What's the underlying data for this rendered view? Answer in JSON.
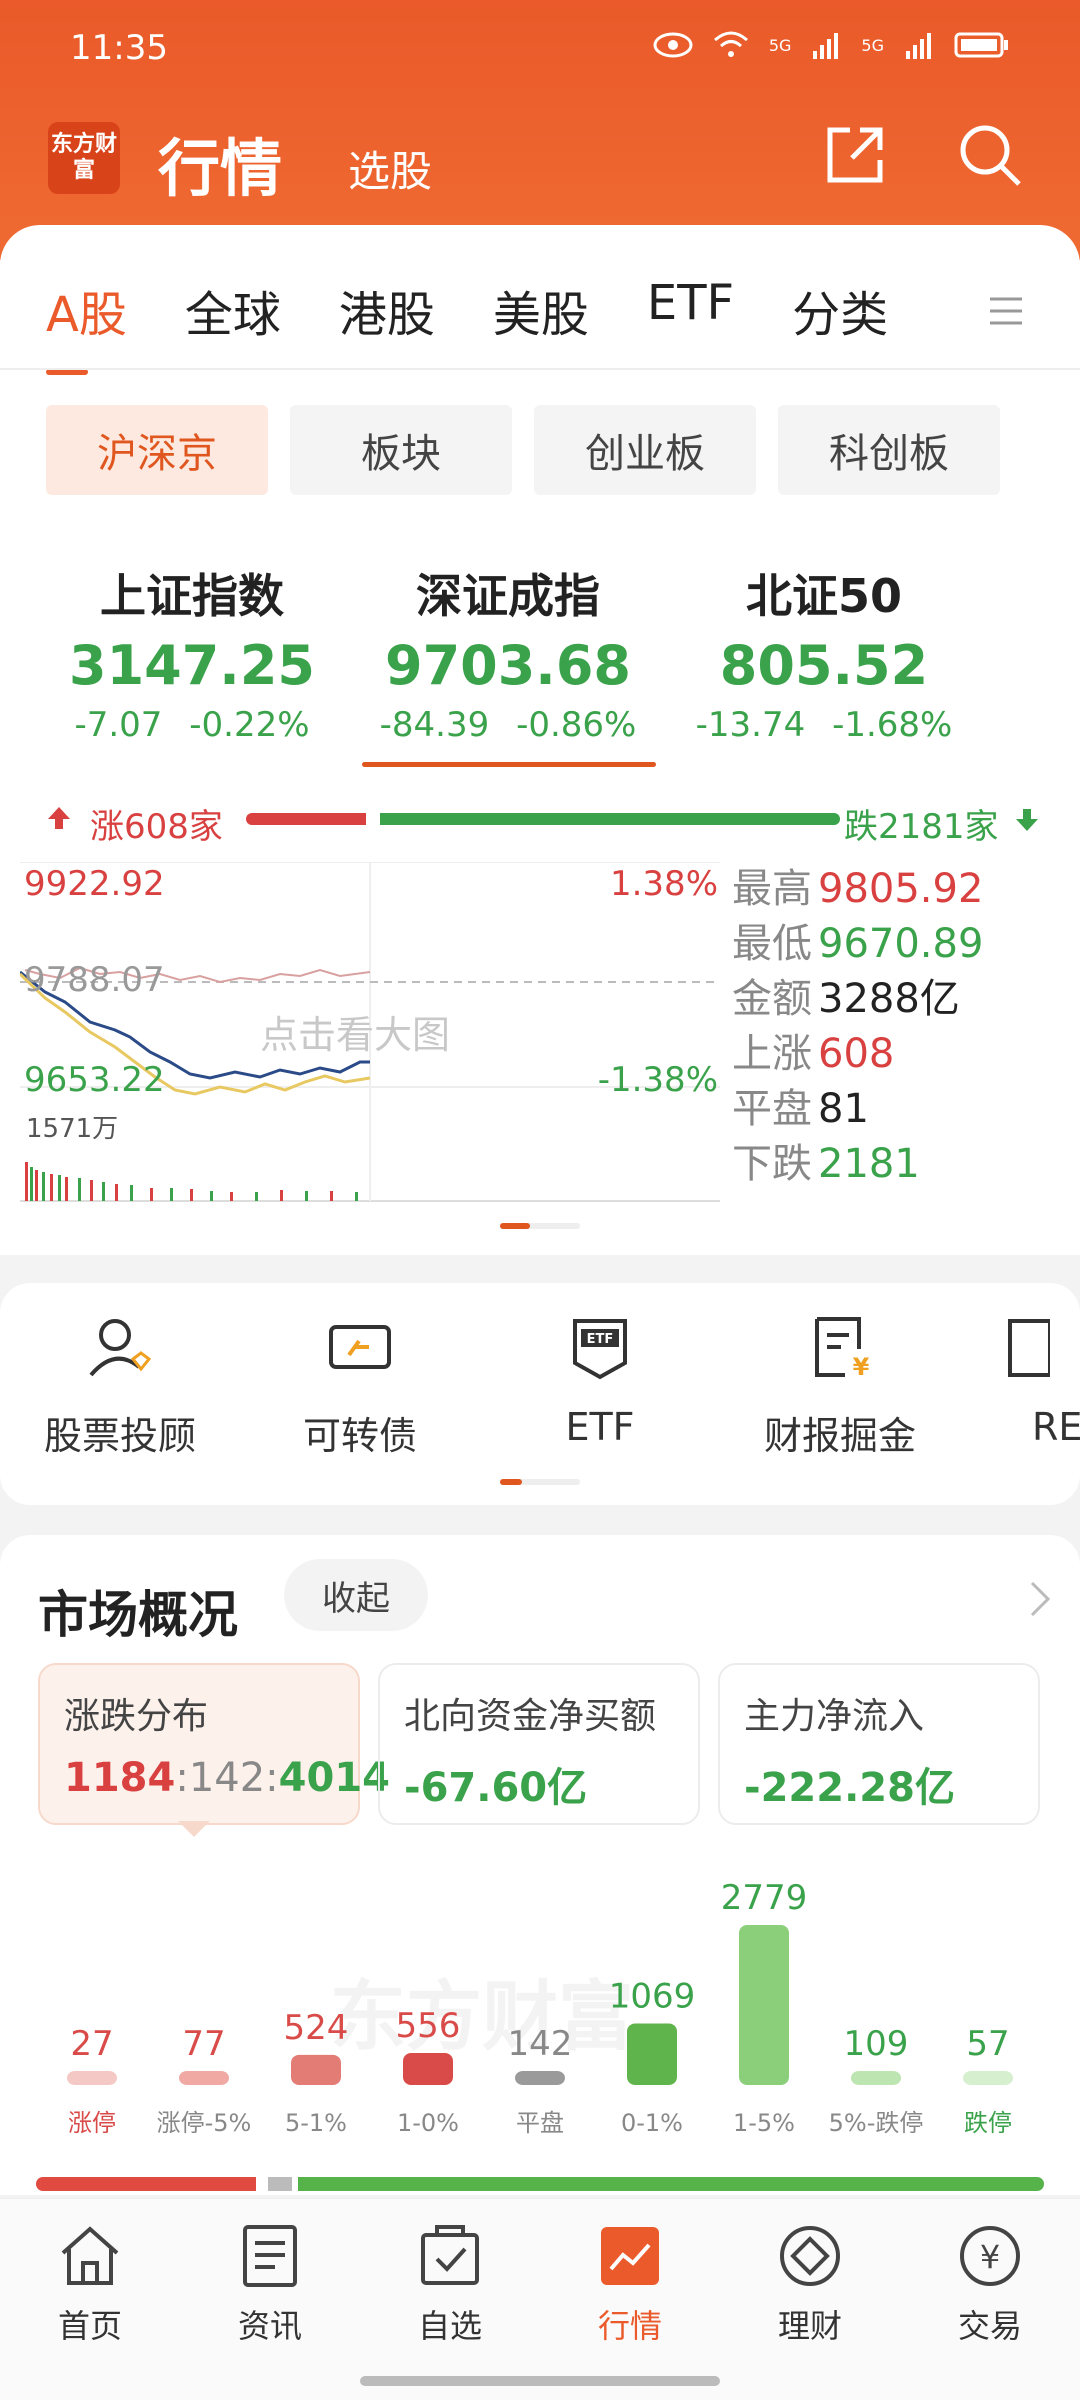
{
  "status": {
    "time": "11:35",
    "signal1": "5G",
    "signal2": "5G"
  },
  "header": {
    "logo_text": "东方财富",
    "title": "行情",
    "subtitle": "选股"
  },
  "tabs": [
    "A股",
    "全球",
    "港股",
    "美股",
    "ETF",
    "分类"
  ],
  "chips": [
    "沪深京",
    "板块",
    "创业板",
    "科创板"
  ],
  "indices": [
    {
      "name": "上证指数",
      "value": "3147.25",
      "change": "-7.07",
      "pct": "-0.22%"
    },
    {
      "name": "深证成指",
      "value": "9703.68",
      "change": "-84.39",
      "pct": "-0.86%"
    },
    {
      "name": "北证50",
      "value": "805.52",
      "change": "-13.74",
      "pct": "-1.68%"
    }
  ],
  "breadth": {
    "up": "涨608家",
    "down": "跌2181家",
    "up_count": 608,
    "flat_count": 81,
    "down_count": 2181
  },
  "chart": {
    "high_label": "9922.92",
    "low_label": "9653.22",
    "mid_label": "9788.07",
    "pct_up": "1.38%",
    "pct_down": "-1.38%",
    "volume": "1571万",
    "hint": "点击看大图"
  },
  "stats": [
    {
      "label": "最高",
      "value": "9805.92",
      "color": "#d94141"
    },
    {
      "label": "最低",
      "value": "9670.89",
      "color": "#3aa24a"
    },
    {
      "label": "金额",
      "value": "3288亿",
      "color": "#222222"
    },
    {
      "label": "上涨",
      "value": "608",
      "color": "#d94141"
    },
    {
      "label": "平盘",
      "value": "81",
      "color": "#222222"
    },
    {
      "label": "下跌",
      "value": "2181",
      "color": "#3aa24a"
    }
  ],
  "tools": [
    "股票投顾",
    "可转债",
    "ETF",
    "财报掘金",
    "RE"
  ],
  "tool_icons": [
    "advisor-icon",
    "bond-icon",
    "etf-icon",
    "report-icon",
    "reit-icon"
  ],
  "market": {
    "title": "市场概况",
    "collapse": "收起",
    "cards": [
      {
        "title": "涨跌分布",
        "up": "1184",
        "flat": "142",
        "down": "4014",
        "sep": ":"
      },
      {
        "title": "北向资金净买额",
        "value": "-67.60亿"
      },
      {
        "title": "主力净流入",
        "value": "-222.28亿"
      }
    ],
    "watermark": "东方财富"
  },
  "chart_data": {
    "type": "bar",
    "categories": [
      "涨停",
      "涨停-5%",
      "5-1%",
      "1-0%",
      "平盘",
      "0-1%",
      "1-5%",
      "5%-跌停",
      "跌停"
    ],
    "values": [
      27,
      77,
      524,
      556,
      142,
      1069,
      2779,
      109,
      57
    ],
    "colors": [
      "#f4c9c5",
      "#f0a9a3",
      "#e47c76",
      "#d94b48",
      "#9a9a9a",
      "#5fb54b",
      "#8ccf7b",
      "#bde5b1",
      "#d6efcf"
    ],
    "label_colors": [
      "#d94b48",
      "#d94b48",
      "#d94b48",
      "#d94b48",
      "#888888",
      "#3aa24a",
      "#3aa24a",
      "#3aa24a",
      "#3aa24a"
    ]
  },
  "nav": [
    "首页",
    "资讯",
    "自选",
    "行情",
    "理财",
    "交易"
  ],
  "nav_icons": [
    "home-icon",
    "news-icon",
    "watchlist-icon",
    "market-icon",
    "wealth-icon",
    "trade-icon"
  ],
  "colors": {
    "brand": "#ea5a2a",
    "up": "#d94141",
    "down": "#3aa24a"
  }
}
